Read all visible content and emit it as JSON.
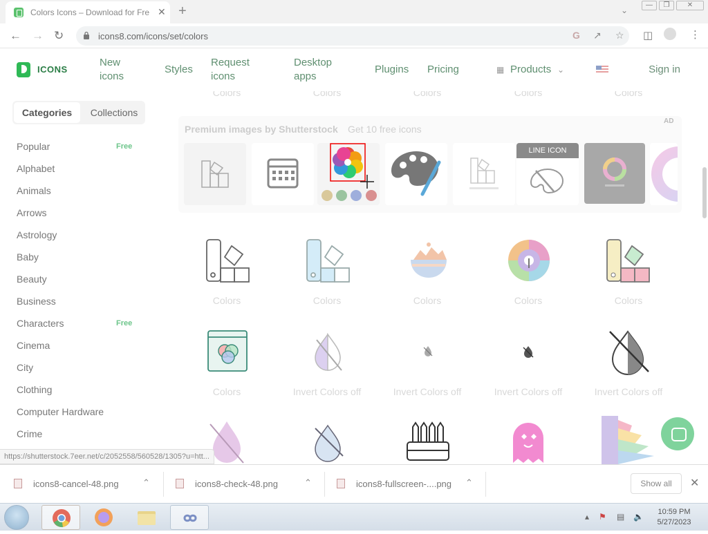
{
  "browser": {
    "tab_title": "Colors Icons – Download for Fre",
    "close_tab": "✕",
    "new_tab": "+",
    "url": "icons8.com/icons/set/colors"
  },
  "header": {
    "logo_text": "ICONS",
    "nav": [
      "New icons",
      "Styles",
      "Request icons",
      "Desktop apps",
      "Plugins",
      "Pricing",
      "Products"
    ],
    "signin": "Sign in"
  },
  "sidebar": {
    "tabs": [
      "Categories",
      "Collections"
    ],
    "categories": [
      {
        "label": "Popular",
        "badge": "Free"
      },
      {
        "label": "Alphabet",
        "badge": ""
      },
      {
        "label": "Animals",
        "badge": ""
      },
      {
        "label": "Arrows",
        "badge": ""
      },
      {
        "label": "Astrology",
        "badge": ""
      },
      {
        "label": "Baby",
        "badge": ""
      },
      {
        "label": "Beauty",
        "badge": ""
      },
      {
        "label": "Business",
        "badge": ""
      },
      {
        "label": "Characters",
        "badge": "Free"
      },
      {
        "label": "Cinema",
        "badge": ""
      },
      {
        "label": "City",
        "badge": ""
      },
      {
        "label": "Clothing",
        "badge": ""
      },
      {
        "label": "Computer Hardware",
        "badge": ""
      },
      {
        "label": "Crime",
        "badge": ""
      }
    ]
  },
  "main": {
    "top_captions": [
      "Colors",
      "Colors",
      "Colors",
      "Colors",
      "Colors"
    ],
    "promo": {
      "title": "Premium images by Shutterstock",
      "link": "Get 10 free icons",
      "ad": "AD",
      "thumb_text": "LINE ICON",
      "thumb_names": [
        "swatch-fan-icon",
        "calendar-icon",
        "color-wheel-icon",
        "palette-brush-icon",
        "color-swatch-icon",
        "line-palette-icon",
        "color-ring-icon",
        "gradient-circle-icon"
      ]
    },
    "row1": [
      {
        "icon": "swatch-outline-icon",
        "caption": "Colors"
      },
      {
        "icon": "swatch-blue-icon",
        "caption": "Colors"
      },
      {
        "icon": "paint-bowl-icon",
        "caption": "Colors"
      },
      {
        "icon": "color-wheel-search-icon",
        "caption": "Colors"
      },
      {
        "icon": "swatch-color-icon",
        "caption": "Colors"
      }
    ],
    "row2": [
      {
        "icon": "rgb-circles-icon",
        "caption": "Colors"
      },
      {
        "icon": "invert-colors-off-icon",
        "caption": "Invert Colors off"
      },
      {
        "icon": "invert-colors-off-small-icon",
        "caption": "Invert Colors off"
      },
      {
        "icon": "invert-colors-off-small-icon",
        "caption": "Invert Colors off"
      },
      {
        "icon": "invert-colors-off-large-icon",
        "caption": "Invert Colors off"
      }
    ]
  },
  "status_url": "https://shutterstock.7eer.net/c/2052558/560528/1305?u=htt...",
  "downloads": {
    "items": [
      "icons8-cancel-48.png",
      "icons8-check-48.png",
      "icons8-fullscreen-....png"
    ],
    "show_all": "Show all"
  },
  "taskbar": {
    "time": "10:59 PM",
    "date": "5/27/2023"
  }
}
